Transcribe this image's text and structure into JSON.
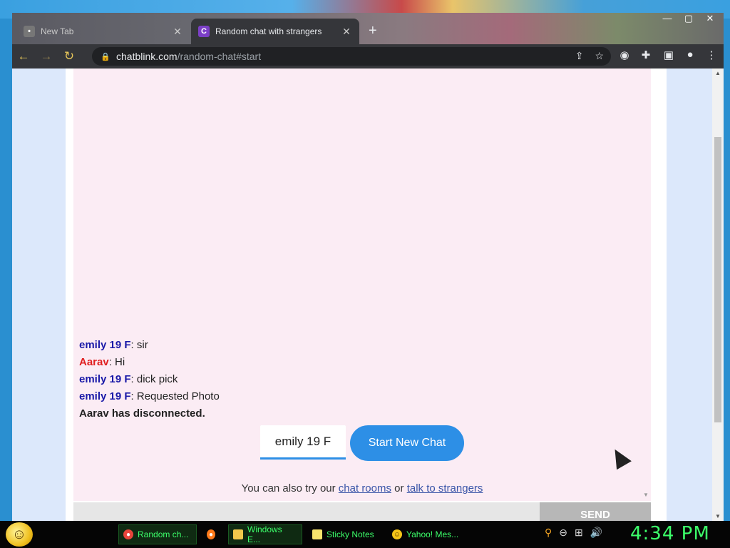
{
  "browser": {
    "tabs": [
      {
        "label": "New Tab",
        "active": false
      },
      {
        "label": "Random chat with strangers",
        "active": true
      }
    ],
    "url_host": "chatblink.com",
    "url_path": "/random-chat#start"
  },
  "chat": {
    "messages": [
      {
        "nick": "emily 19 F",
        "text": ": sir",
        "role": "stranger"
      },
      {
        "nick": "Aarav",
        "text": ": Hi",
        "role": "you"
      },
      {
        "nick": "emily 19 F",
        "text": ": dick pick",
        "role": "stranger"
      },
      {
        "nick": "emily 19 F",
        "text": ": Requested Photo",
        "role": "stranger"
      }
    ],
    "status": "Aarav has disconnected.",
    "name_value": "emily 19 F",
    "start_label": "Start New Chat",
    "also_prefix": "You can also try our",
    "link_rooms": "chat rooms",
    "also_or": "or",
    "link_strangers": "talk to strangers",
    "send_label": "SEND"
  },
  "taskbar": {
    "items": [
      {
        "label": "Random ch..."
      },
      {
        "label": "Windows E..."
      },
      {
        "label": "Sticky Notes"
      },
      {
        "label": "Yahoo! Mes..."
      }
    ],
    "clock": "4:34 PM"
  },
  "colors": {
    "accent": "#2d8fe6",
    "stranger_nick": "#1a1aa8",
    "you_nick": "#e02020",
    "taskbar_text": "#3cff6a"
  }
}
